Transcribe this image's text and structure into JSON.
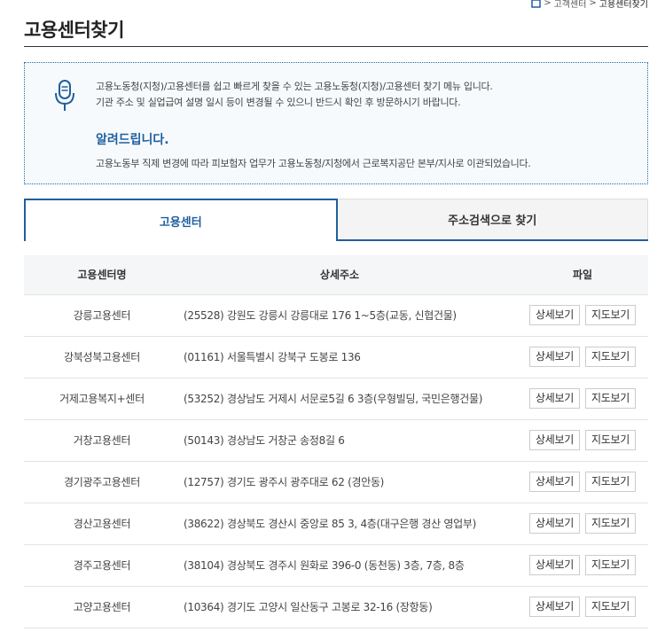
{
  "breadcrumb": {
    "items": [
      "고객센터",
      "고용센터찾기"
    ]
  },
  "page_title": "고용센터찾기",
  "notice": {
    "line1": "고용노동청(지청)/고용센터를 쉽고 빠르게 찾을 수 있는 고용노동청(지청)/고용센터 찾기 메뉴 입니다.",
    "line2": "기관 주소 및 실업급여 설명 일시 등이 변경될 수 있으니 반드시 확인 후 방문하시기 바랍니다.",
    "heading": "알려드립니다.",
    "line3": "고용노동부 직제 변경에 따라 피보험자 업무가 고용노동청/지청에서 근로복지공단 본부/지사로 이관되었습니다."
  },
  "tabs": [
    {
      "label": "고용센터",
      "active": true
    },
    {
      "label": "주소검색으로 찾기",
      "active": false
    }
  ],
  "table": {
    "headers": {
      "name": "고용센터명",
      "address": "상세주소",
      "file": "파일"
    },
    "detail_label": "상세보기",
    "map_label": "지도보기",
    "rows": [
      {
        "name": "강릉고용센터",
        "address": "(25528) 강원도 강릉시 강릉대로 176 1~5층(교동, 신협건물)"
      },
      {
        "name": "강북성북고용센터",
        "address": "(01161) 서울특별시 강북구 도봉로 136"
      },
      {
        "name": "거제고용복지+센터",
        "address": "(53252) 경상남도 거제시 서문로5길 6 3층(우형빌딩, 국민은행건물)"
      },
      {
        "name": "거창고용센터",
        "address": "(50143) 경상남도 거창군 송정8길 6"
      },
      {
        "name": "경기광주고용센터",
        "address": "(12757) 경기도 광주시 광주대로 62 (경안동)"
      },
      {
        "name": "경산고용센터",
        "address": "(38622) 경상북도 경산시 중앙로 85 3, 4층(대구은행 경산 영업부)"
      },
      {
        "name": "경주고용센터",
        "address": "(38104) 경상북도 경주시 원화로 396-0 (동천동) 3층, 7층, 8층"
      },
      {
        "name": "고양고용센터",
        "address": "(10364) 경기도 고양시 일산동구 고봉로 32-16 (장항동)"
      }
    ]
  },
  "colors": {
    "accent": "#1f5f9e",
    "notice_border": "#1f6ea8",
    "notice_bg": "#f7fafd"
  }
}
